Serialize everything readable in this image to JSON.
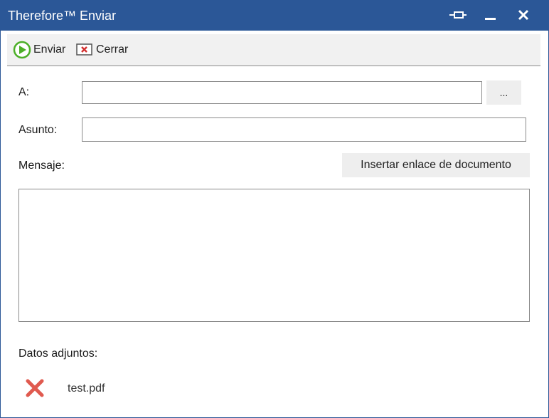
{
  "window": {
    "title": "Therefore™ Enviar"
  },
  "toolbar": {
    "send_label": "Enviar",
    "close_label": "Cerrar"
  },
  "form": {
    "to_label": "A:",
    "to_value": "",
    "browse_label": "...",
    "subject_label": "Asunto:",
    "subject_value": "",
    "message_label": "Mensaje:",
    "message_value": "",
    "insert_link_label": "Insertar enlace de documento",
    "attachments_label": "Datos adjuntos:"
  },
  "attachments": [
    {
      "name": "test.pdf"
    }
  ],
  "icons": {
    "pin": "pin-icon",
    "minimize": "minimize-icon",
    "close": "close-icon",
    "send": "play-circle-icon",
    "close_doc": "close-document-icon",
    "remove_attachment": "red-x-icon"
  },
  "colors": {
    "titlebar": "#2b5797",
    "send_icon": "#4caf28",
    "remove_icon": "#e05a4f"
  }
}
